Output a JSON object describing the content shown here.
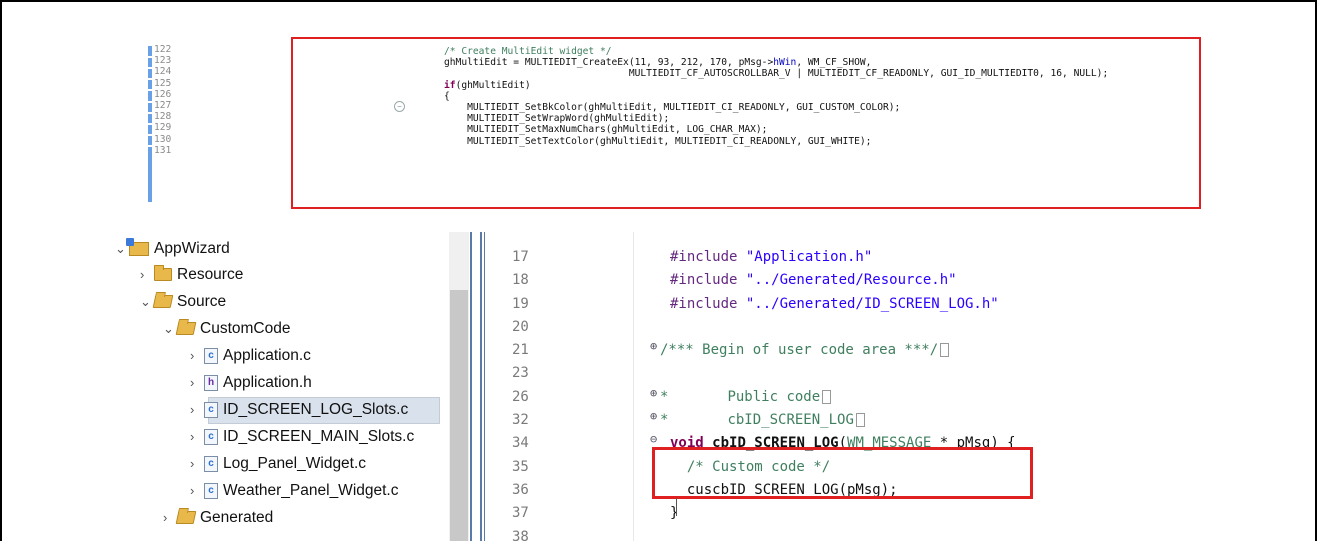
{
  "snippet": {
    "line_numbers": [
      "122",
      "123",
      "124",
      "125",
      "126",
      "127",
      "128",
      "129",
      "130",
      "131"
    ],
    "fold_icon": "collapse-icon",
    "lines": [
      [
        {
          "t": "/* Create MultiEdit widget */",
          "c": "c-comment"
        }
      ],
      [
        {
          "t": "ghMultiEdit = MULTIEDIT_CreateEx(11, 93, 212, 170, pMsg->",
          "c": ""
        },
        {
          "t": "hWin",
          "c": "c-field"
        },
        {
          "t": ", WM_CF_SHOW,",
          "c": ""
        }
      ],
      [
        {
          "t": "                                MULTIEDIT_CF_AUTOSCROLLBAR_V | MULTIEDIT_CF_READONLY, GUI_ID_MULTIEDIT0, 16, NULL);",
          "c": ""
        }
      ],
      [
        {
          "t": "if",
          "c": "c-kw"
        },
        {
          "t": "(ghMultiEdit)",
          "c": ""
        }
      ],
      [
        {
          "t": "{",
          "c": ""
        }
      ],
      [
        {
          "t": "    MULTIEDIT_SetBkColor(ghMultiEdit, MULTIEDIT_CI_READONLY, GUI_CUSTOM_COLOR);",
          "c": ""
        }
      ],
      [
        {
          "t": "    MULTIEDIT_SetWrapWord(ghMultiEdit);",
          "c": ""
        }
      ],
      [
        {
          "t": "    MULTIEDIT_SetMaxNumChars(ghMultiEdit, LOG_CHAR_MAX);",
          "c": ""
        }
      ],
      [
        {
          "t": "    MULTIEDIT_SetTextColor(ghMultiEdit, MULTIEDIT_CI_READONLY, GUI_WHITE);",
          "c": ""
        }
      ]
    ]
  },
  "explorer": {
    "items": [
      {
        "label": "AppWizard",
        "arrow": "⌄",
        "icon": "project-folder-icon",
        "expanded": true
      },
      {
        "label": "Resource",
        "arrow": "›",
        "icon": "folder-icon",
        "expanded": false
      },
      {
        "label": "Source",
        "arrow": "⌄",
        "icon": "folder-open-icon",
        "expanded": true
      },
      {
        "label": "CustomCode",
        "arrow": "⌄",
        "icon": "folder-open-icon",
        "expanded": true
      },
      {
        "label": "Application.c",
        "arrow": "›",
        "icon": "c-file-icon",
        "glyph": "c"
      },
      {
        "label": "Application.h",
        "arrow": "›",
        "icon": "h-file-icon",
        "glyph": "h"
      },
      {
        "label": "ID_SCREEN_LOG_Slots.c",
        "arrow": "›",
        "icon": "c-file-icon",
        "glyph": "c",
        "selected": true
      },
      {
        "label": "ID_SCREEN_MAIN_Slots.c",
        "arrow": "›",
        "icon": "c-file-icon",
        "glyph": "c"
      },
      {
        "label": "Log_Panel_Widget.c",
        "arrow": "›",
        "icon": "c-file-icon",
        "glyph": "c"
      },
      {
        "label": "Weather_Panel_Widget.c",
        "arrow": "›",
        "icon": "c-file-icon",
        "glyph": "c"
      },
      {
        "label": "Generated",
        "arrow": "›",
        "icon": "folder-open-icon",
        "expanded": false
      }
    ]
  },
  "editor": {
    "line_numbers": [
      "17",
      "18",
      "19",
      "20",
      "21",
      "23",
      "26",
      "32",
      "34",
      "35",
      "36",
      "37",
      "38"
    ],
    "lines": [
      [
        {
          "t": "#include ",
          "c": "c-macro"
        },
        {
          "t": "\"Application.h\"",
          "c": "c-str"
        }
      ],
      [
        {
          "t": "#include ",
          "c": "c-macro"
        },
        {
          "t": "\"../Generated/Resource.h\"",
          "c": "c-str"
        }
      ],
      [
        {
          "t": "#include ",
          "c": "c-macro"
        },
        {
          "t": "\"../Generated/ID_SCREEN_LOG.h\"",
          "c": "c-str"
        }
      ],
      [
        {
          "t": "",
          "c": ""
        }
      ],
      [
        {
          "t": "/*** Begin of user code area ***/",
          "c": "c-comment"
        }
      ],
      [
        {
          "t": "",
          "c": ""
        }
      ],
      [
        {
          "t": "*       ",
          "c": "c-comment"
        },
        {
          "t": "Public code",
          "c": "c-comment"
        }
      ],
      [
        {
          "t": "*       ",
          "c": "c-comment"
        },
        {
          "t": "cbID_SCREEN_LOG",
          "c": "c-comment"
        }
      ],
      [
        {
          "t": "void ",
          "c": "c-kw"
        },
        {
          "t": "cbID_SCREEN_LOG",
          "c": "c-bold"
        },
        {
          "t": "(",
          "c": ""
        },
        {
          "t": "WM_MESSAGE",
          "c": "c-comment"
        },
        {
          "t": " * pMsg) {",
          "c": ""
        }
      ],
      [
        {
          "t": "  /* Custom code */",
          "c": "c-comment"
        }
      ],
      [
        {
          "t": "  cuscbID_SCREEN_LOG(pMsg);",
          "c": ""
        }
      ],
      [
        {
          "t": "}",
          "c": ""
        }
      ],
      [
        {
          "t": "",
          "c": ""
        }
      ]
    ],
    "fold_icons": [
      "expand-icon",
      "expand-icon",
      "expand-icon",
      "collapse-icon"
    ]
  }
}
